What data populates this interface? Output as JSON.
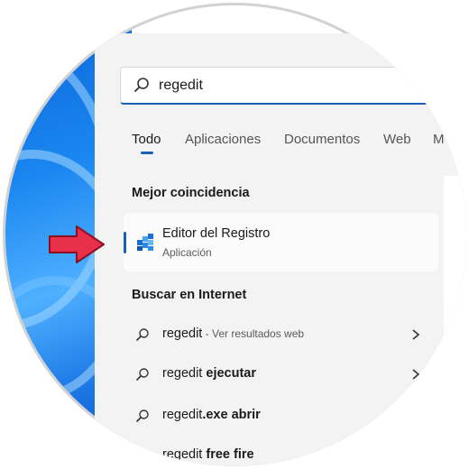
{
  "search": {
    "query": "regedit"
  },
  "tabs": [
    {
      "label": "Todo",
      "active": true
    },
    {
      "label": "Aplicaciones"
    },
    {
      "label": "Documentos"
    },
    {
      "label": "Web"
    },
    {
      "label": "M"
    }
  ],
  "best_match": {
    "heading": "Mejor coincidencia",
    "title": "Editor del Registro",
    "subtitle": "Aplicación",
    "icon": "registry-editor-icon"
  },
  "web": {
    "heading": "Buscar en Internet",
    "results": [
      {
        "base": "regedit",
        "bold": "",
        "sub": " - Ver resultados web"
      },
      {
        "base": "regedit ",
        "bold": "ejecutar",
        "sub": ""
      },
      {
        "base": "regedit",
        "bold": ".exe abrir",
        "sub": ""
      },
      {
        "base": "regedit ",
        "bold": "free fire",
        "sub": ""
      }
    ]
  },
  "colors": {
    "accent": "#1a5fb4",
    "arrow": "#e8304a",
    "panel": "#f3f3f3"
  }
}
